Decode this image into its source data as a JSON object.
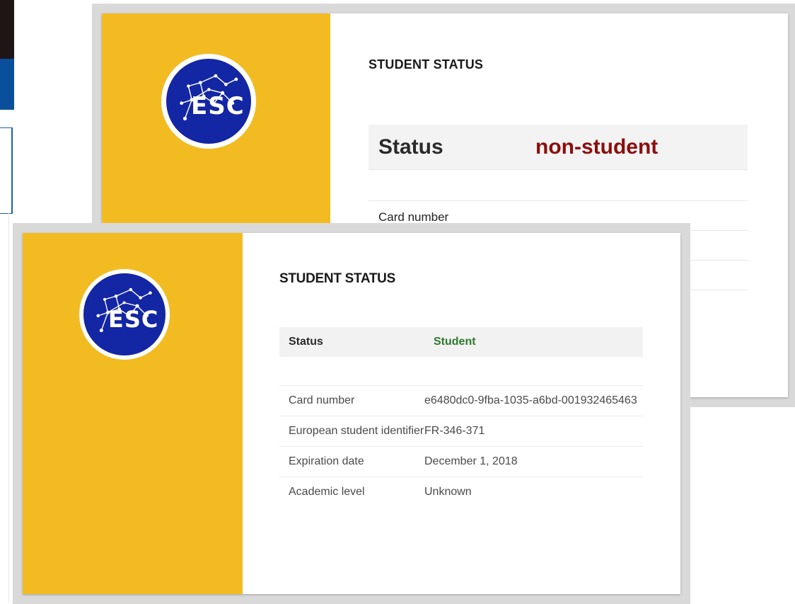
{
  "cards": [
    {
      "id": "back",
      "logo_text": "ESC",
      "section_title": "STUDENT STATUS",
      "status_label": "Status",
      "status_value": "non-student",
      "status_color": "#8c0d0d",
      "rows": [
        {
          "label": "Card number"
        }
      ]
    },
    {
      "id": "front",
      "logo_text": "ESC",
      "section_title": "STUDENT STATUS",
      "status_label": "Status",
      "status_value": "Student",
      "status_color": "#2d7a2d",
      "rows": [
        {
          "label": "Card number",
          "value": "e6480dc0-9fba-1035-a6bd-001932465463"
        },
        {
          "label": "European student identifier",
          "value": "FR-346-371"
        },
        {
          "label": "Expiration date",
          "value": "December 1, 2018"
        },
        {
          "label": "Academic level",
          "value": "Unknown"
        }
      ]
    }
  ],
  "colors": {
    "sidebar_yellow": "#f3bb22",
    "logo_blue": "#1326a3",
    "frame_gray": "#d9d9d9"
  },
  "icons": {
    "logo": "esc-constellation-logo-icon"
  }
}
